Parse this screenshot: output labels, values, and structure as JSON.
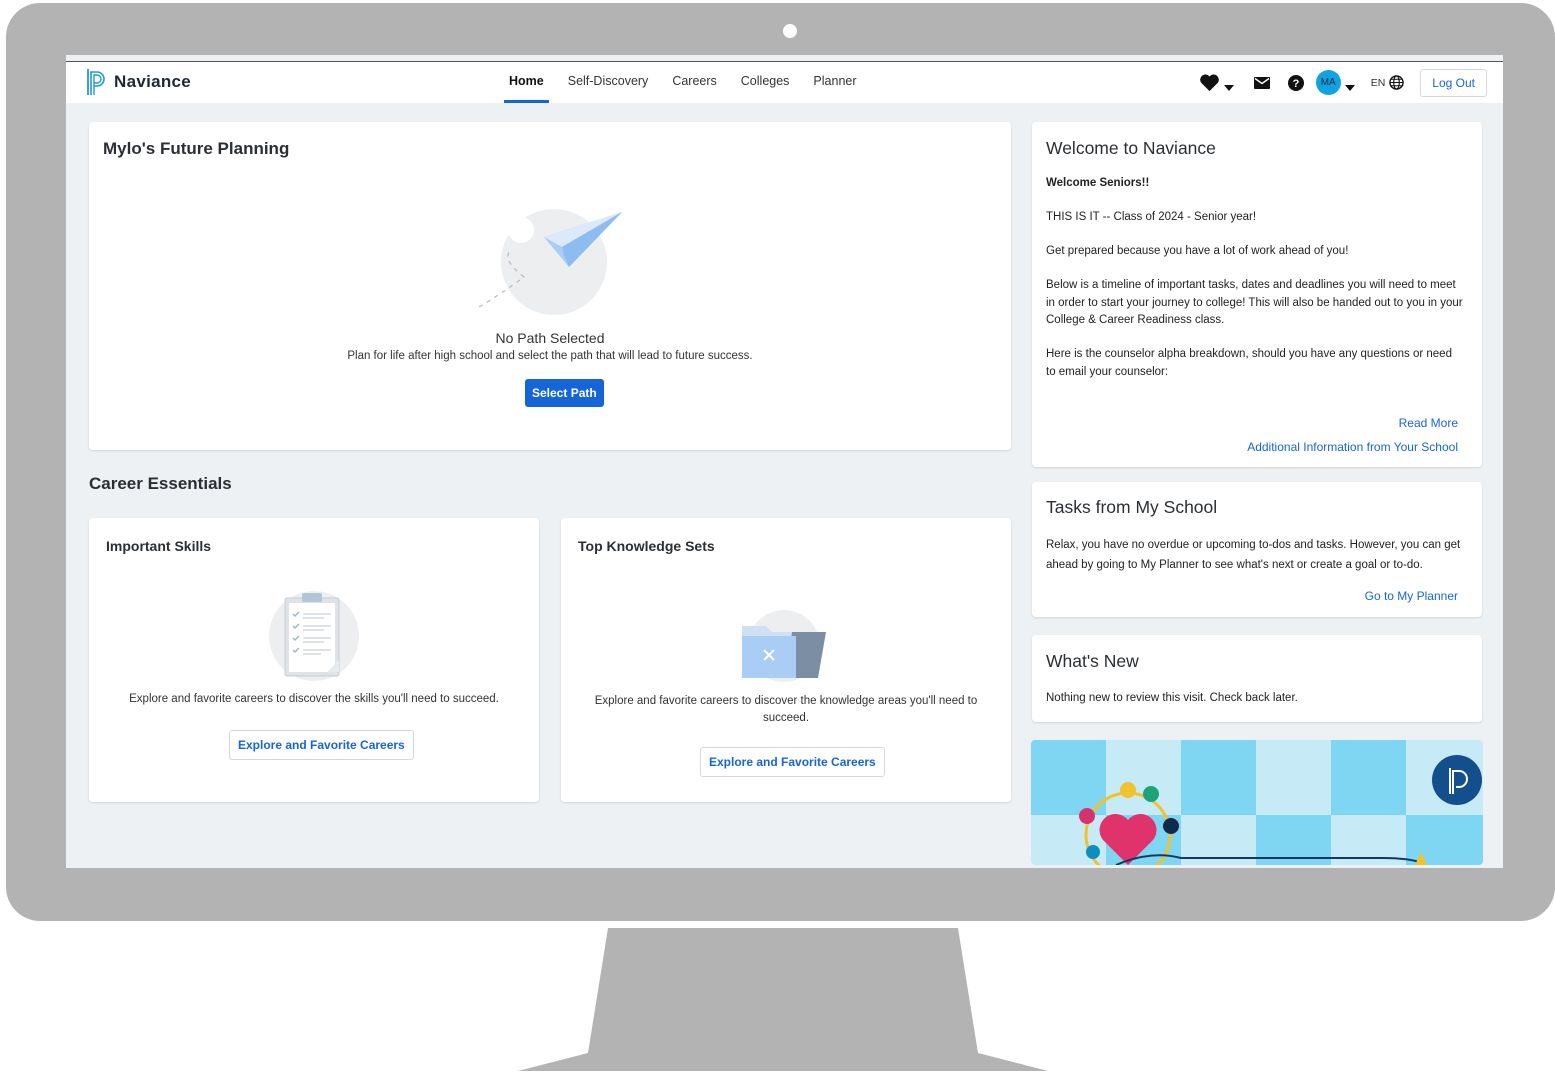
{
  "app": {
    "name": "Naviance"
  },
  "nav": {
    "links": [
      {
        "label": "Home",
        "active": true
      },
      {
        "label": "Self-Discovery"
      },
      {
        "label": "Careers"
      },
      {
        "label": "Colleges"
      },
      {
        "label": "Planner"
      }
    ],
    "avatar_initials": "MA",
    "language": "EN",
    "logout_label": "Log Out"
  },
  "planning": {
    "title": "Mylo's Future Planning",
    "empty_title": "No Path Selected",
    "empty_text": "Plan for life after high school and select the path that will lead to future success.",
    "button_label": "Select Path"
  },
  "career_essentials": {
    "heading": "Career Essentials",
    "skills": {
      "title": "Important Skills",
      "text": "Explore and favorite careers to discover the skills you'll need to succeed.",
      "button_label": "Explore and Favorite Careers"
    },
    "knowledge": {
      "title": "Top Knowledge Sets",
      "text": "Explore and favorite careers to discover the knowledge areas you'll need to succeed.",
      "button_label": "Explore and Favorite Careers"
    }
  },
  "welcome": {
    "title": "Welcome to Naviance",
    "subtitle": "Welcome Seniors!!",
    "paragraphs": [
      "THIS IS IT -- Class of 2024 - Senior year!",
      "Get prepared because you have a lot of work ahead of you!",
      "Below is a timeline of important tasks, dates and deadlines you will need to meet in order to start your journey to college! This will also be handed out to you in your College & Career Readiness class.",
      "Here is the counselor alpha breakdown, should you have any questions or need to email your counselor:"
    ],
    "read_more": "Read More",
    "additional_info": "Additional Information from Your School"
  },
  "tasks": {
    "title": "Tasks from My School",
    "text": "Relax, you have no overdue or upcoming to-dos and tasks. However, you can get ahead by going to My Planner to see what's next or create a goal or to-do.",
    "link": "Go to My Planner"
  },
  "whats_new": {
    "title": "What's New",
    "text": "Nothing new to review this visit. Check back later."
  },
  "colors": {
    "accent": "#1565d8",
    "monitor": "#b3b3b3",
    "screen_bg": "#eef1f3",
    "avatar": "#0fa3e3",
    "promo_light": "#c6ebf7",
    "promo_dark": "#7ed6f2",
    "promo_badge": "#134f8c"
  },
  "icons": [
    "naviance-logo-icon",
    "heart-icon",
    "mail-icon",
    "help-icon",
    "globe-icon",
    "paper-plane-illustration",
    "clipboard-illustration",
    "folder-illustration"
  ]
}
